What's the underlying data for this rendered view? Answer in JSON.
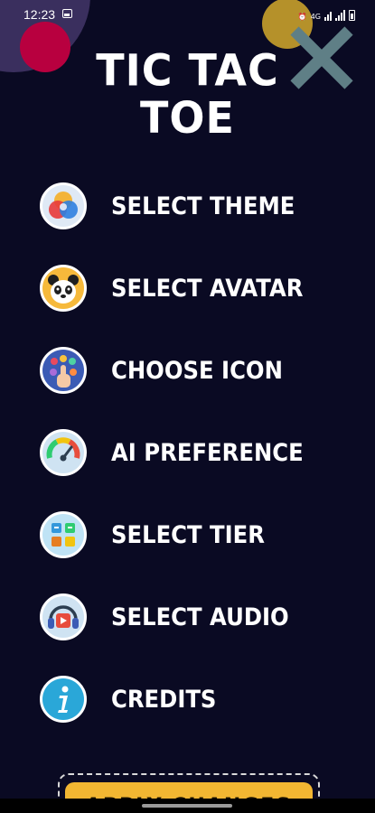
{
  "status_bar": {
    "time": "12:23",
    "network_label": "4G"
  },
  "title": {
    "line1": "TIC TAC",
    "line2": "TOE"
  },
  "menu": {
    "items": [
      {
        "label": "SELECT THEME",
        "icon": "theme-color-wheel-icon"
      },
      {
        "label": "SELECT AVATAR",
        "icon": "panda-avatar-icon"
      },
      {
        "label": "CHOOSE ICON",
        "icon": "touch-hand-icon"
      },
      {
        "label": "AI PREFERENCE",
        "icon": "speedometer-gauge-icon"
      },
      {
        "label": "SELECT TIER",
        "icon": "grid-tiles-icon"
      },
      {
        "label": "SELECT AUDIO",
        "icon": "headphones-play-icon"
      },
      {
        "label": "CREDITS",
        "icon": "info-icon"
      }
    ]
  },
  "apply_button": {
    "label": "APPLY CHANGES"
  },
  "colors": {
    "background": "#0a0a23",
    "accent_yellow": "#f2b632",
    "x_mark": "#5f7f86",
    "deco_magenta": "#b8003f"
  }
}
